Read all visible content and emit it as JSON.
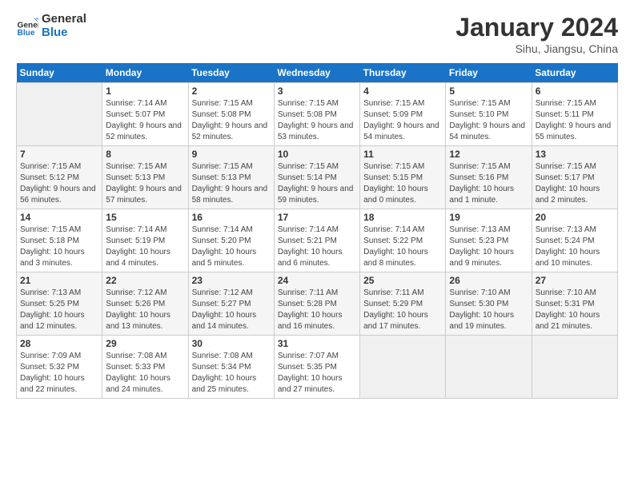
{
  "logo": {
    "line1": "General",
    "line2": "Blue"
  },
  "title": "January 2024",
  "location": "Sihu, Jiangsu, China",
  "days_of_week": [
    "Sunday",
    "Monday",
    "Tuesday",
    "Wednesday",
    "Thursday",
    "Friday",
    "Saturday"
  ],
  "weeks": [
    [
      {
        "day": "",
        "empty": true
      },
      {
        "day": "1",
        "sunrise": "7:14 AM",
        "sunset": "5:07 PM",
        "daylight": "9 hours and 52 minutes."
      },
      {
        "day": "2",
        "sunrise": "7:15 AM",
        "sunset": "5:08 PM",
        "daylight": "9 hours and 52 minutes."
      },
      {
        "day": "3",
        "sunrise": "7:15 AM",
        "sunset": "5:08 PM",
        "daylight": "9 hours and 53 minutes."
      },
      {
        "day": "4",
        "sunrise": "7:15 AM",
        "sunset": "5:09 PM",
        "daylight": "9 hours and 54 minutes."
      },
      {
        "day": "5",
        "sunrise": "7:15 AM",
        "sunset": "5:10 PM",
        "daylight": "9 hours and 54 minutes."
      },
      {
        "day": "6",
        "sunrise": "7:15 AM",
        "sunset": "5:11 PM",
        "daylight": "9 hours and 55 minutes."
      }
    ],
    [
      {
        "day": "7",
        "sunrise": "7:15 AM",
        "sunset": "5:12 PM",
        "daylight": "9 hours and 56 minutes."
      },
      {
        "day": "8",
        "sunrise": "7:15 AM",
        "sunset": "5:13 PM",
        "daylight": "9 hours and 57 minutes."
      },
      {
        "day": "9",
        "sunrise": "7:15 AM",
        "sunset": "5:13 PM",
        "daylight": "9 hours and 58 minutes."
      },
      {
        "day": "10",
        "sunrise": "7:15 AM",
        "sunset": "5:14 PM",
        "daylight": "9 hours and 59 minutes."
      },
      {
        "day": "11",
        "sunrise": "7:15 AM",
        "sunset": "5:15 PM",
        "daylight": "10 hours and 0 minutes."
      },
      {
        "day": "12",
        "sunrise": "7:15 AM",
        "sunset": "5:16 PM",
        "daylight": "10 hours and 1 minute."
      },
      {
        "day": "13",
        "sunrise": "7:15 AM",
        "sunset": "5:17 PM",
        "daylight": "10 hours and 2 minutes."
      }
    ],
    [
      {
        "day": "14",
        "sunrise": "7:15 AM",
        "sunset": "5:18 PM",
        "daylight": "10 hours and 3 minutes."
      },
      {
        "day": "15",
        "sunrise": "7:14 AM",
        "sunset": "5:19 PM",
        "daylight": "10 hours and 4 minutes."
      },
      {
        "day": "16",
        "sunrise": "7:14 AM",
        "sunset": "5:20 PM",
        "daylight": "10 hours and 5 minutes."
      },
      {
        "day": "17",
        "sunrise": "7:14 AM",
        "sunset": "5:21 PM",
        "daylight": "10 hours and 6 minutes."
      },
      {
        "day": "18",
        "sunrise": "7:14 AM",
        "sunset": "5:22 PM",
        "daylight": "10 hours and 8 minutes."
      },
      {
        "day": "19",
        "sunrise": "7:13 AM",
        "sunset": "5:23 PM",
        "daylight": "10 hours and 9 minutes."
      },
      {
        "day": "20",
        "sunrise": "7:13 AM",
        "sunset": "5:24 PM",
        "daylight": "10 hours and 10 minutes."
      }
    ],
    [
      {
        "day": "21",
        "sunrise": "7:13 AM",
        "sunset": "5:25 PM",
        "daylight": "10 hours and 12 minutes."
      },
      {
        "day": "22",
        "sunrise": "7:12 AM",
        "sunset": "5:26 PM",
        "daylight": "10 hours and 13 minutes."
      },
      {
        "day": "23",
        "sunrise": "7:12 AM",
        "sunset": "5:27 PM",
        "daylight": "10 hours and 14 minutes."
      },
      {
        "day": "24",
        "sunrise": "7:11 AM",
        "sunset": "5:28 PM",
        "daylight": "10 hours and 16 minutes."
      },
      {
        "day": "25",
        "sunrise": "7:11 AM",
        "sunset": "5:29 PM",
        "daylight": "10 hours and 17 minutes."
      },
      {
        "day": "26",
        "sunrise": "7:10 AM",
        "sunset": "5:30 PM",
        "daylight": "10 hours and 19 minutes."
      },
      {
        "day": "27",
        "sunrise": "7:10 AM",
        "sunset": "5:31 PM",
        "daylight": "10 hours and 21 minutes."
      }
    ],
    [
      {
        "day": "28",
        "sunrise": "7:09 AM",
        "sunset": "5:32 PM",
        "daylight": "10 hours and 22 minutes."
      },
      {
        "day": "29",
        "sunrise": "7:08 AM",
        "sunset": "5:33 PM",
        "daylight": "10 hours and 24 minutes."
      },
      {
        "day": "30",
        "sunrise": "7:08 AM",
        "sunset": "5:34 PM",
        "daylight": "10 hours and 25 minutes."
      },
      {
        "day": "31",
        "sunrise": "7:07 AM",
        "sunset": "5:35 PM",
        "daylight": "10 hours and 27 minutes."
      },
      {
        "day": "",
        "empty": true
      },
      {
        "day": "",
        "empty": true
      },
      {
        "day": "",
        "empty": true
      }
    ]
  ],
  "labels": {
    "sunrise": "Sunrise:",
    "sunset": "Sunset:",
    "daylight": "Daylight:"
  }
}
